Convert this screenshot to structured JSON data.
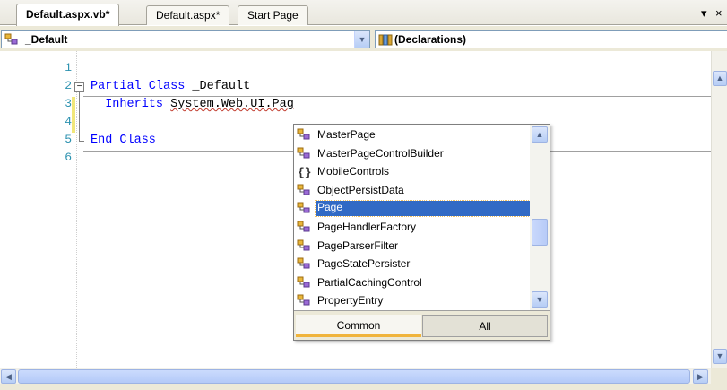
{
  "tabs": [
    {
      "label": "Default.aspx.vb*",
      "active": true
    },
    {
      "label": "Default.aspx*",
      "active": false
    },
    {
      "label": "Start Page",
      "active": false
    }
  ],
  "tab_controls": {
    "dropdown": "▾",
    "close": "×"
  },
  "navbar": {
    "class_combo": {
      "value": "_Default",
      "icon": "class-icon"
    },
    "member_combo": {
      "value": "(Declarations)",
      "icon": "declarations-icon"
    }
  },
  "editor": {
    "line_numbers": [
      "1",
      "2",
      "3",
      "4",
      "5",
      "6"
    ],
    "lines": {
      "l2_kw": "Partial Class",
      "l2_rest": " _Default",
      "l3_kw": "Inherits",
      "l3_rest": "System.Web.UI.Pag",
      "l5_kw": "End Class"
    }
  },
  "intellisense": {
    "items": [
      {
        "label": "MasterPage",
        "icon": "class-icon",
        "selected": false
      },
      {
        "label": "MasterPageControlBuilder",
        "icon": "class-icon",
        "selected": false
      },
      {
        "label": "MobileControls",
        "icon": "namespace-icon",
        "selected": false
      },
      {
        "label": "ObjectPersistData",
        "icon": "class-icon",
        "selected": false
      },
      {
        "label": "Page",
        "icon": "class-icon",
        "selected": true
      },
      {
        "label": "PageHandlerFactory",
        "icon": "class-icon",
        "selected": false
      },
      {
        "label": "PageParserFilter",
        "icon": "class-icon",
        "selected": false
      },
      {
        "label": "PageStatePersister",
        "icon": "class-icon",
        "selected": false
      },
      {
        "label": "PartialCachingControl",
        "icon": "class-icon",
        "selected": false
      },
      {
        "label": "PropertyEntry",
        "icon": "class-icon",
        "selected": false
      }
    ],
    "tabs": {
      "common": "Common",
      "all": "All"
    },
    "active_tab": "Common"
  },
  "colors": {
    "keyword": "#0000ff",
    "line_number": "#2b91af",
    "selection": "#316ac5",
    "chrome": "#ece9d8"
  }
}
